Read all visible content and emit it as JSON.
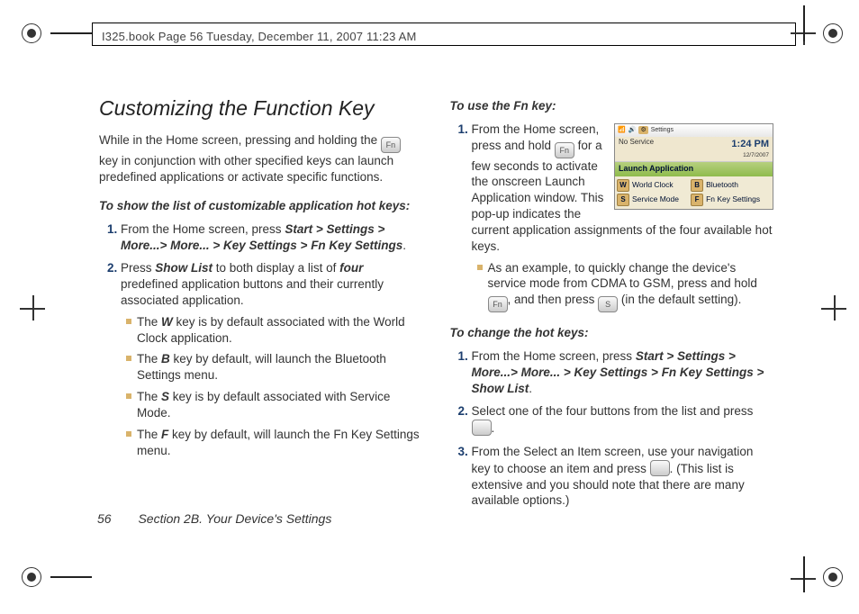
{
  "header": "I325.book  Page 56  Tuesday, December 11, 2007  11:23 AM",
  "title": "Customizing the Function Key",
  "intro_before_icon": "While in the Home screen, pressing and holding the ",
  "intro_after_icon": " key in conjunction with other specified keys can launch predefined applications or activate specific functions.",
  "subhead1": "To show the list of customizable application hot keys:",
  "step1a_pre": "From the Home screen, press ",
  "step1a_path": "Start > Settings > More...> More... > Key Settings > Fn Key Settings",
  "step1a_post": ".",
  "step1b_pre": "Press ",
  "step1b_showlist": "Show List",
  "step1b_mid": " to both display a list of ",
  "step1b_four": "four",
  "step1b_post": " predefined application buttons and their currently associated application.",
  "sub_w_pre": "The ",
  "sub_w_key": "W",
  "sub_w_post": " key is by default associated with the World Clock application.",
  "sub_b_pre": "The ",
  "sub_b_key": "B",
  "sub_b_post": " key by default, will launch the Bluetooth Settings menu.",
  "sub_s_pre": "The ",
  "sub_s_key": "S",
  "sub_s_post": " key is by default associated with Service Mode.",
  "sub_f_pre": "The ",
  "sub_f_key": "F",
  "sub_f_post": " key by default, will launch the Fn Key Settings menu.",
  "subhead2": "To use the Fn key:",
  "r1_pre": "From the Home screen, press and hold ",
  "r1_post": " for a few seconds to activate the onscreen Launch Application window. This pop-up indicates the current application assignments of the four available hot keys.",
  "r1_ex_pre": "As an example, to quickly change the device's service mode from CDMA to GSM, press and hold ",
  "r1_ex_mid": ", and then press ",
  "r1_ex_post": " (in the default setting).",
  "subhead3": "To change the hot keys:",
  "c1_pre": "From the Home screen, press ",
  "c1_path": "Start > Settings > More...> More... > Key Settings > Fn Key Settings > Show List",
  "c1_post": ".",
  "c2_pre": "Select one of the four buttons from the list and press ",
  "c2_post": ".",
  "c3_pre": "From the Select an Item screen, use your navigation key to choose an item and press ",
  "c3_post": ". (This list is extensive and you should note that there are many available options.)",
  "footer_page": "56",
  "footer_section": "Section 2B. Your Device's Settings",
  "ss": {
    "top_settings": "Settings",
    "no_service": "No Service",
    "time": "1:24 PM",
    "date": "12/7/2007",
    "la_title": "Launch Application",
    "w_key": "W",
    "w_label": "World Clock",
    "b_key": "B",
    "b_label": "Bluetooth",
    "s_key": "S",
    "s_label": "Service Mode",
    "f_key": "F",
    "f_label": "Fn Key Settings"
  }
}
